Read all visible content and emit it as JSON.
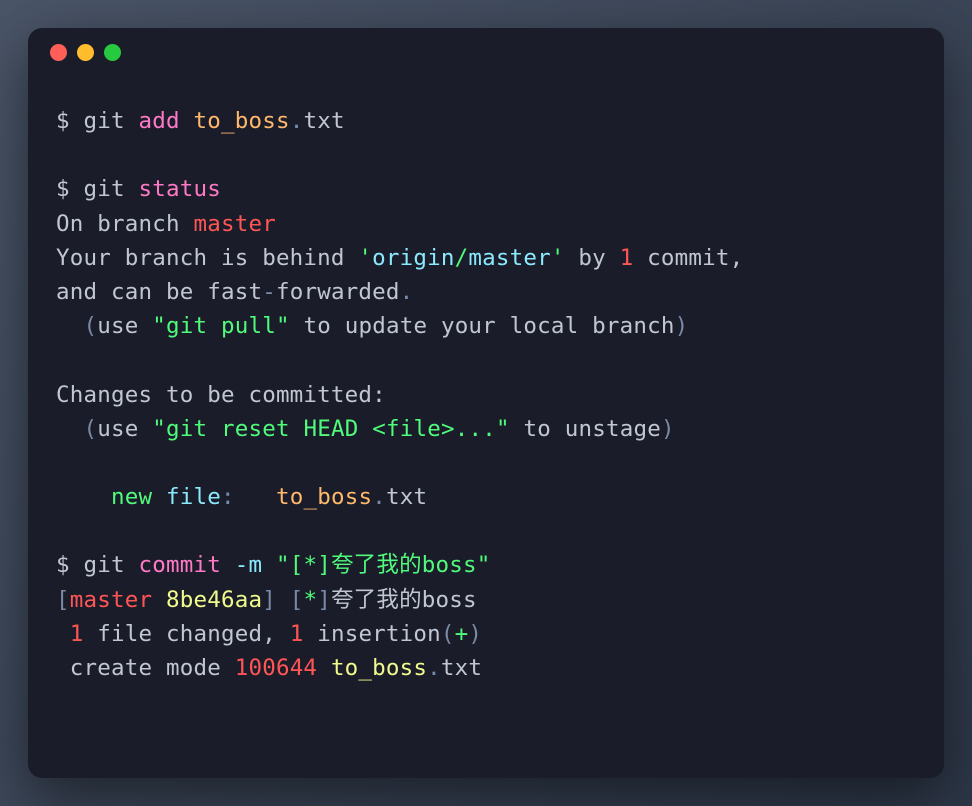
{
  "traffic_lights": [
    "red",
    "yellow",
    "green"
  ],
  "cmd1": {
    "prompt": "$ ",
    "git": "git",
    "add": "add",
    "file": "to_boss",
    "dot": ".",
    "ext": "txt"
  },
  "cmd2": {
    "prompt": "$ ",
    "git": "git",
    "status": "status"
  },
  "status": {
    "on_branch": "On branch ",
    "master": "master",
    "behind1": "Your branch is behind ",
    "q1": "'",
    "origin": "origin",
    "slash": "/",
    "remote_master": "master",
    "q2": "'",
    "by": " by ",
    "one": "1",
    "commit_tail": " commit, ",
    "and_can": "and can be fast",
    "dash": "-",
    "forwarded": "forwarded",
    "period": ".",
    "indent": "  ",
    "open_p": "(",
    "use1": "use ",
    "q3": "\"",
    "git2": "git",
    "pull": " pull",
    "q4": "\"",
    "to_update": " to update your local branch",
    "close_p": ")",
    "changes_hdr": "Changes to be committed:",
    "use2": "use ",
    "q5": "\"",
    "git3": "git",
    "reset": " reset ",
    "head": "HEAD",
    "lt": " <",
    "file_placeholder": "file",
    "gt": ">",
    "dots": "...",
    "q6": "\"",
    "to_unstage": " to unstage",
    "new_indent": "    ",
    "new_kw": "new",
    "file_kw": " file",
    "colon": ":",
    "spaces": "   ",
    "new_file": "to_boss",
    "new_dot": ".",
    "new_ext": "txt"
  },
  "cmd3": {
    "prompt": "$ ",
    "git": "git",
    "commit": "commit",
    "flag": " -m ",
    "q1": "\"",
    "msg_open": "[",
    "star": "*",
    "msg_close": "]",
    "msg_rest": "夸了我的boss",
    "q2": "\""
  },
  "result": {
    "lb": "[",
    "branch": "master",
    "sp": " ",
    "hash": "8be46aa",
    "rb": "]",
    "sp2": " ",
    "mb": "[",
    "star": "*",
    "me": "]",
    "msg": "夸了我的boss",
    "line2_lead": " ",
    "one_a": "1",
    "file_changed": " file changed, ",
    "one_b": "1",
    "insertion": " insertion",
    "lp": "(",
    "plus": "+",
    "rp": ")",
    "line3_lead": " create mode ",
    "mode": "100644",
    "sp3": " ",
    "fname": "to_boss",
    "dot": ".",
    "ext": "txt"
  }
}
